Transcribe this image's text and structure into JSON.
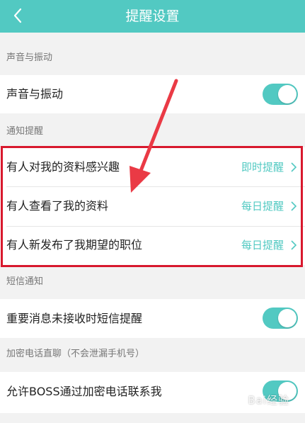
{
  "header": {
    "title": "提醒设置",
    "back_icon": "chevron-left-icon"
  },
  "sections": {
    "sound": {
      "label": "声音与振动",
      "row_label": "声音与振动",
      "toggle_on": true
    },
    "notify": {
      "label": "通知提醒",
      "rows": [
        {
          "label": "有人对我的资料感兴趣",
          "value": "即时提醒"
        },
        {
          "label": "有人查看了我的资料",
          "value": "每日提醒"
        },
        {
          "label": "有人新发布了我期望的职位",
          "value": "每日提醒"
        }
      ]
    },
    "sms": {
      "label": "短信通知",
      "row_label": "重要消息未接收时短信提醒",
      "toggle_on": true
    },
    "call": {
      "label": "加密电话直聊（不会泄漏手机号）",
      "row_label": "允许BOSS通过加密电话联系我",
      "toggle_on": true
    }
  },
  "watermark": "Bai经验",
  "colors": {
    "accent": "#52c9c2",
    "highlight": "#d8182d",
    "background": "#f2f2f2"
  }
}
